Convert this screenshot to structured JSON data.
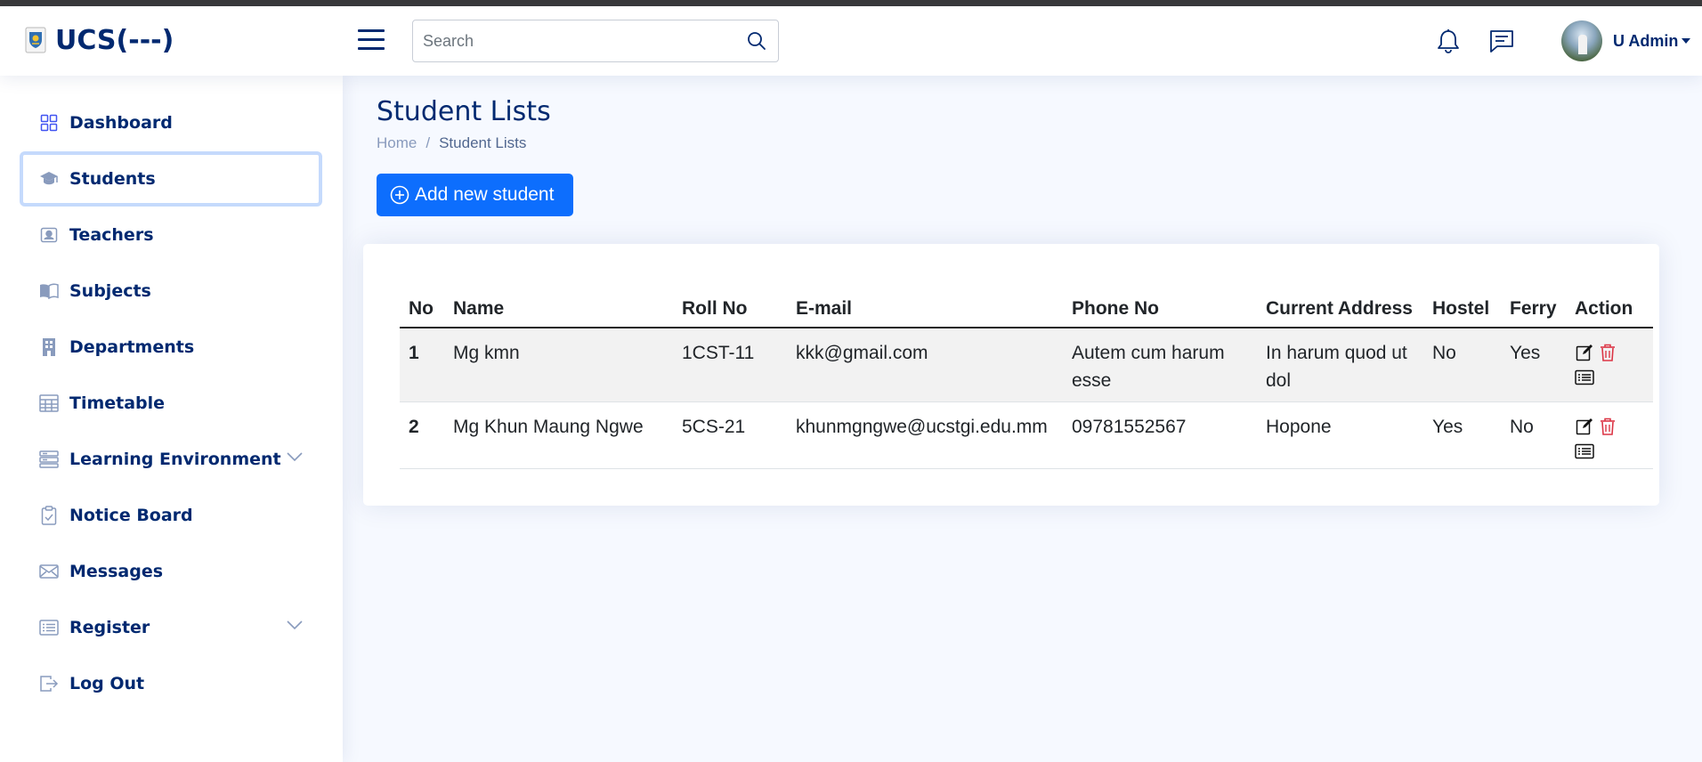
{
  "app": {
    "brand": "UCS(---)"
  },
  "header": {
    "search": {
      "placeholder": "Search",
      "value": ""
    },
    "user": {
      "name": "U Admin"
    }
  },
  "sidebar": {
    "items": [
      {
        "label": "Dashboard",
        "icon": "grid-icon",
        "active": false
      },
      {
        "label": "Students",
        "icon": "mortarboard-icon",
        "active": true
      },
      {
        "label": "Teachers",
        "icon": "person-badge-icon",
        "active": false
      },
      {
        "label": "Subjects",
        "icon": "book-icon",
        "active": false
      },
      {
        "label": "Departments",
        "icon": "building-icon",
        "active": false
      },
      {
        "label": "Timetable",
        "icon": "table-icon",
        "active": false
      },
      {
        "label": "Learning Environment",
        "icon": "layers-icon",
        "active": false,
        "expandable": true
      },
      {
        "label": "Notice Board",
        "icon": "clipboard-check-icon",
        "active": false
      },
      {
        "label": "Messages",
        "icon": "envelope-icon",
        "active": false
      },
      {
        "label": "Register",
        "icon": "list-icon",
        "active": false,
        "expandable": true
      },
      {
        "label": "Log Out",
        "icon": "box-arrow-right-icon",
        "active": false
      }
    ]
  },
  "page": {
    "title": "Student Lists",
    "breadcrumb": {
      "home": "Home",
      "separator": "/",
      "current": "Student Lists"
    },
    "add_button": "Add new student"
  },
  "table": {
    "columns": [
      "No",
      "Name",
      "Roll No",
      "E-mail",
      "Phone No",
      "Current Address",
      "Hostel",
      "Ferry",
      "Action"
    ],
    "rows": [
      {
        "no": "1",
        "name": "Mg kmn",
        "roll": "1CST-11",
        "email": "kkk@gmail.com",
        "phone": "Autem cum harum esse",
        "address": "In harum quod ut dol",
        "hostel": "No",
        "ferry": "Yes"
      },
      {
        "no": "2",
        "name": "Mg Khun Maung Ngwe",
        "roll": "5CS-21",
        "email": "khunmgngwe@ucstgi.edu.mm",
        "phone": "09781552567",
        "address": "Hopone",
        "hostel": "Yes",
        "ferry": "No"
      }
    ]
  },
  "colors": {
    "primary": "#0d6efd",
    "navy": "#012970",
    "danger": "#dc3545",
    "background": "#f6f9ff"
  }
}
